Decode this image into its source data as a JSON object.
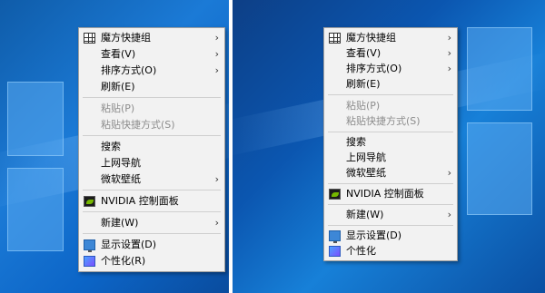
{
  "left_menu": {
    "items": [
      {
        "label": "魔方快捷组",
        "arrow": "›",
        "icon": "grid-icon"
      },
      {
        "label": "查看(V)",
        "arrow": "›"
      },
      {
        "label": "排序方式(O)",
        "arrow": "›"
      },
      {
        "label": "刷新(E)"
      },
      {
        "label": "粘贴(P)",
        "disabled": true
      },
      {
        "label": "粘贴快捷方式(S)",
        "disabled": true
      },
      {
        "label": "搜索"
      },
      {
        "label": "上网导航"
      },
      {
        "label": "微软壁纸",
        "arrow": "›"
      },
      {
        "label": "NVIDIA 控制面板",
        "icon": "nvidia-icon"
      },
      {
        "label": "新建(W)",
        "arrow": "›"
      },
      {
        "label": "显示设置(D)",
        "icon": "display-icon"
      },
      {
        "label": "个性化(R)",
        "icon": "personalize-icon"
      }
    ]
  },
  "right_menu": {
    "items": [
      {
        "label": "魔方快捷组",
        "arrow": "›",
        "icon": "grid-icon"
      },
      {
        "label": "查看(V)",
        "arrow": "›"
      },
      {
        "label": "排序方式(O)",
        "arrow": "›"
      },
      {
        "label": "刷新(E)"
      },
      {
        "label": "粘贴(P)",
        "disabled": true
      },
      {
        "label": "粘贴快捷方式(S)",
        "disabled": true
      },
      {
        "label": "搜索"
      },
      {
        "label": "上网导航"
      },
      {
        "label": "微软壁纸",
        "arrow": "›"
      },
      {
        "label": "NVIDIA 控制面板",
        "icon": "nvidia-icon"
      },
      {
        "label": "新建(W)",
        "arrow": "›"
      },
      {
        "label": "显示设置(D)",
        "icon": "display-icon"
      },
      {
        "label": "个性化",
        "icon": "personalize-icon"
      }
    ]
  }
}
